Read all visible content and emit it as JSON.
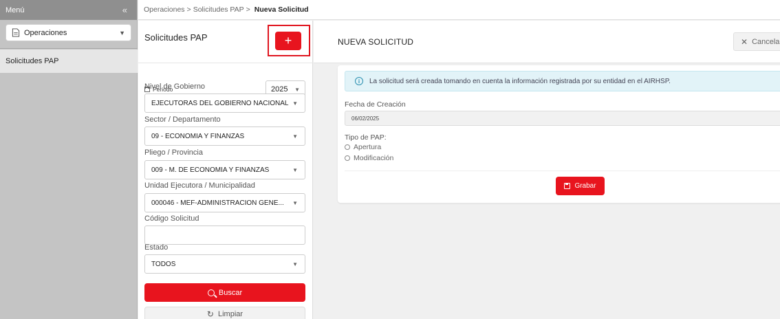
{
  "sidebar": {
    "title": "Menú",
    "collapse_icon": "double-chevron-left-icon",
    "module_select": "Operaciones",
    "items": [
      {
        "label": "Solicitudes PAP"
      }
    ]
  },
  "breadcrumb": {
    "parts": [
      "Operaciones",
      "Solicitudes PAP"
    ],
    "separator": ">",
    "current": "Nueva Solicitud"
  },
  "left_panel": {
    "title": "Solicitudes PAP",
    "add_label": "+",
    "periodo_label": "Periodo",
    "periodo_value": "2025",
    "fields": {
      "nivel": {
        "label": "Nivel de Gobierno",
        "value": "EJECUTORAS DEL GOBIERNO NACIONAL"
      },
      "sector": {
        "label": "Sector / Departamento",
        "value": "09 - ECONOMIA Y FINANZAS"
      },
      "pliego": {
        "label": "Pliego / Provincia",
        "value": "009 - M. DE ECONOMIA Y FINANZAS"
      },
      "unidad": {
        "label": "Unidad Ejecutora / Municipalidad",
        "value": "000046 - MEF-ADMINISTRACION GENE..."
      },
      "codigo": {
        "label": "Código Solicitud",
        "value": ""
      },
      "estado": {
        "label": "Estado",
        "value": "TODOS"
      }
    },
    "buscar_label": "Buscar",
    "limpiar_label": "Limpiar"
  },
  "right_panel": {
    "title": "NUEVA SOLICITUD",
    "cancel_label": "Cancelar",
    "info_message": "La solicitud será creada tomando en cuenta la información registrada por su entidad en el AIRHSP.",
    "fecha_label": "Fecha de Creación",
    "fecha_value": "06/02/2025",
    "tipo_label": "Tipo de PAP:",
    "tipo_options": [
      "Apertura",
      "Modificación"
    ],
    "grabar_label": "Grabar"
  },
  "colors": {
    "accent_red": "#e8141e",
    "sidebar_bg": "#c4c4c4",
    "sidebar_header": "#8f8f8f",
    "info_bg": "#e2f3f8"
  }
}
